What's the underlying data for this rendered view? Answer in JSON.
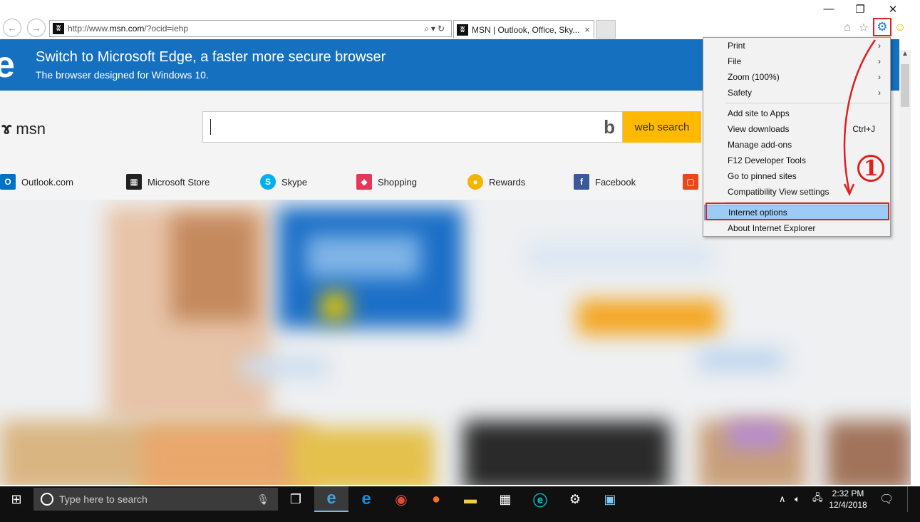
{
  "browser": {
    "url_prefix": "http://www.",
    "url_domain": "msn.com",
    "url_suffix": "/?ocid=iehp",
    "tab_title": "MSN | Outlook, Office, Sky...",
    "tab_close": "×",
    "window": {
      "minimize": "—",
      "restore": "❐",
      "close": "✕"
    }
  },
  "edge_banner": {
    "title": "Switch to Microsoft Edge, a faster more secure browser",
    "subtitle": "The browser designed for Windows 10."
  },
  "msn": {
    "logo_text": "msn",
    "search_placeholder": "",
    "search_button": "web search",
    "quick_links": [
      {
        "label": "Outlook.com",
        "color": "#0072c6",
        "glyph": "O"
      },
      {
        "label": "Microsoft Store",
        "color": "#222222",
        "glyph": "▦"
      },
      {
        "label": "Skype",
        "color": "#00aff0",
        "glyph": "S"
      },
      {
        "label": "Shopping",
        "color": "#e6375a",
        "glyph": "◆"
      },
      {
        "label": "Rewards",
        "color": "#f5b400",
        "glyph": "●"
      },
      {
        "label": "Facebook",
        "color": "#3b5998",
        "glyph": "f"
      }
    ]
  },
  "tools_menu": {
    "items": [
      {
        "label": "Print",
        "submenu": true
      },
      {
        "label": "File",
        "submenu": true
      },
      {
        "label": "Zoom (100%)",
        "submenu": true
      },
      {
        "label": "Safety",
        "submenu": true
      },
      {
        "label": "Add site to Apps"
      },
      {
        "label": "View downloads",
        "shortcut": "Ctrl+J"
      },
      {
        "label": "Manage add-ons"
      },
      {
        "label": "F12 Developer Tools"
      },
      {
        "label": "Go to pinned sites"
      },
      {
        "label": "Compatibility View settings"
      },
      {
        "label": "Internet options",
        "highlighted": true
      },
      {
        "label": "About Internet Explorer"
      }
    ]
  },
  "annotation": {
    "number": "1",
    "color": "#e02020"
  },
  "taskbar": {
    "search_placeholder": "Type here to search",
    "time": "2:32 PM",
    "date": "12/4/2018"
  }
}
